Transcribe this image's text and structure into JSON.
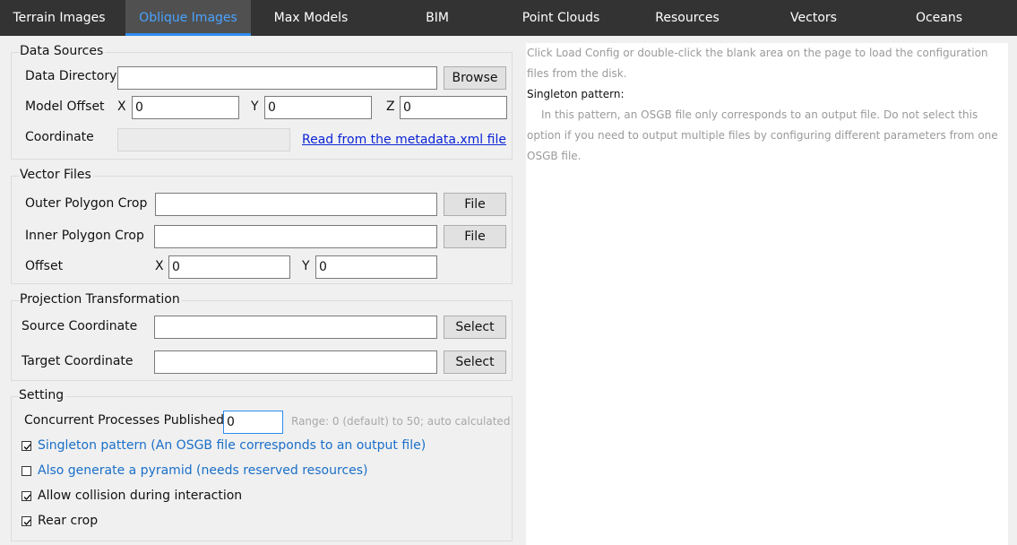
{
  "tabs": [
    {
      "label": "Terrain Images",
      "active": false
    },
    {
      "label": "Oblique Images",
      "active": true
    },
    {
      "label": "Max Models",
      "active": false
    },
    {
      "label": "BIM",
      "active": false
    },
    {
      "label": "Point Clouds",
      "active": false
    },
    {
      "label": "Resources",
      "active": false
    },
    {
      "label": "Vectors",
      "active": false
    },
    {
      "label": "Oceans",
      "active": false
    }
  ],
  "data_sources": {
    "title": "Data Sources",
    "data_directory_label": "Data Directory",
    "data_directory_value": "",
    "browse_label": "Browse",
    "model_offset_label": "Model Offset",
    "x_label": "X",
    "x_value": "0",
    "y_label": "Y",
    "y_value": "0",
    "z_label": "Z",
    "z_value": "0",
    "coordinate_label": "Coordinate",
    "coordinate_value": "",
    "metadata_link": "Read from the metadata.xml file"
  },
  "vector_files": {
    "title": "Vector Files",
    "outer_label": "Outer Polygon Crop",
    "outer_value": "",
    "outer_button": "File",
    "inner_label": "Inner Polygon Crop",
    "inner_value": "",
    "inner_button": "File",
    "offset_label": "Offset",
    "x_label": "X",
    "x_value": "0",
    "y_label": "Y",
    "y_value": "0"
  },
  "projection": {
    "title": "Projection Transformation",
    "source_label": "Source Coordinate",
    "source_value": "",
    "source_button": "Select",
    "target_label": "Target Coordinate",
    "target_value": "",
    "target_button": "Select"
  },
  "setting": {
    "title": "Setting",
    "concurrent_label": "Concurrent Processes Published",
    "concurrent_value": "0",
    "range_hint": "Range: 0 (default) to 50; auto calculated",
    "options": [
      {
        "label": "Singleton pattern (An OSGB file corresponds to an output file)",
        "checked": true
      },
      {
        "label": "Also generate a pyramid (needs reserved resources)",
        "checked": false
      },
      {
        "label": "Allow collision during interaction",
        "checked": true
      },
      {
        "label": "Rear crop",
        "checked": true
      }
    ]
  },
  "help_panel": {
    "intro": "Click Load Config or double-click the blank area on the page to load the configuration files from the disk.",
    "heading": "Singleton pattern:",
    "body": "In this pattern, an OSGB file only corresponds to an output file. Do not select this option if you need to output multiple files by configuring different parameters from one OSGB file."
  },
  "colors": {
    "tabbar_bg": "#333333",
    "active_tab_bg": "#505050",
    "active_tab_text": "#4aa3ff",
    "link_color": "#0b24d6",
    "option_blue": "#1a6fc9"
  }
}
